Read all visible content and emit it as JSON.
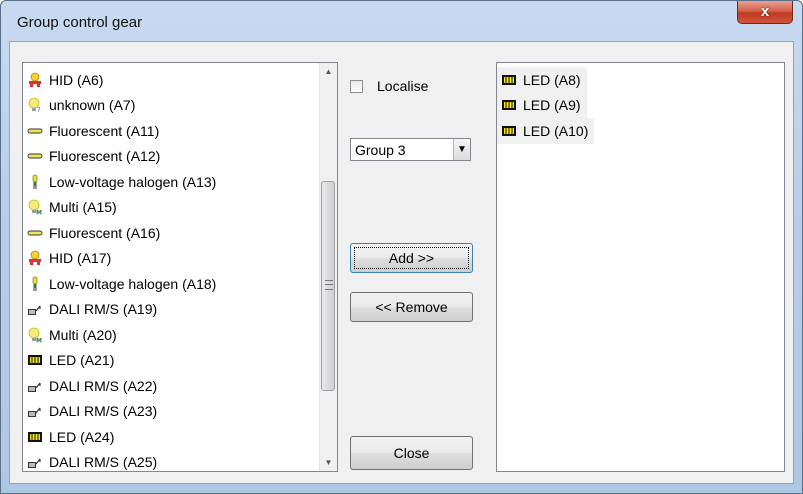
{
  "window": {
    "title": "Group control gear",
    "close_glyph": "x"
  },
  "left_list": {
    "items": [
      {
        "label": "HID (A6)",
        "icon": "hid-lamp-icon"
      },
      {
        "label": "unknown (A7)",
        "icon": "unknown-bulb-icon"
      },
      {
        "label": "Fluorescent (A11)",
        "icon": "fluorescent-tube-icon"
      },
      {
        "label": "Fluorescent (A12)",
        "icon": "fluorescent-tube-icon"
      },
      {
        "label": "Low-voltage halogen (A13)",
        "icon": "halogen-lamp-icon"
      },
      {
        "label": "Multi (A15)",
        "icon": "multi-bulb-icon"
      },
      {
        "label": "Fluorescent (A16)",
        "icon": "fluorescent-tube-icon"
      },
      {
        "label": "HID (A17)",
        "icon": "hid-lamp-icon"
      },
      {
        "label": "Low-voltage halogen (A18)",
        "icon": "halogen-lamp-icon"
      },
      {
        "label": "DALI RM/S (A19)",
        "icon": "relay-switch-icon"
      },
      {
        "label": "Multi (A20)",
        "icon": "multi-bulb-icon"
      },
      {
        "label": "LED (A21)",
        "icon": "led-icon"
      },
      {
        "label": "DALI RM/S (A22)",
        "icon": "relay-switch-icon"
      },
      {
        "label": "DALI RM/S (A23)",
        "icon": "relay-switch-icon"
      },
      {
        "label": "LED (A24)",
        "icon": "led-icon"
      },
      {
        "label": "DALI RM/S (A25)",
        "icon": "relay-switch-icon"
      }
    ]
  },
  "right_list": {
    "items": [
      {
        "label": "LED (A8)",
        "icon": "led-icon"
      },
      {
        "label": "LED (A9)",
        "icon": "led-icon"
      },
      {
        "label": "LED (A10)",
        "icon": "led-icon"
      }
    ]
  },
  "localise": {
    "label": "Localise",
    "checked": false
  },
  "group_select": {
    "value": "Group 3"
  },
  "buttons": {
    "add": "Add >>",
    "remove": "<< Remove",
    "close": "Close"
  },
  "colors": {
    "title_bar": "#b9cfe9",
    "close_button": "#c8462c",
    "dialog_bg": "#f0f0f0"
  }
}
